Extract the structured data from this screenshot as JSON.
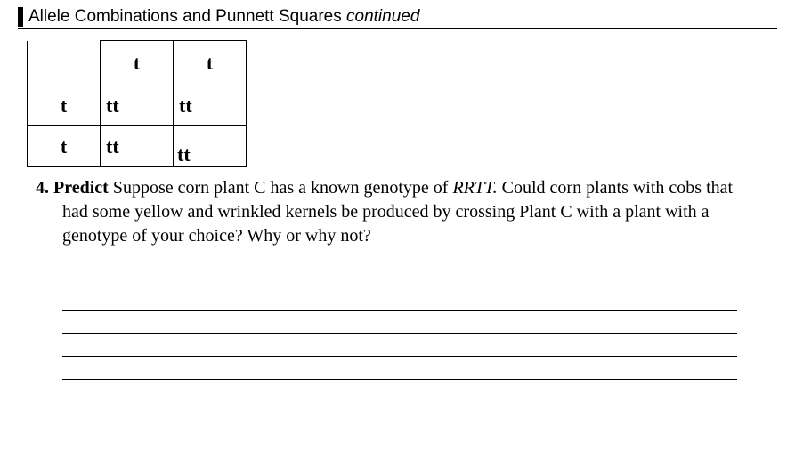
{
  "header": {
    "title_main": "Allele Combinations and Punnett Squares ",
    "title_suffix": "continued"
  },
  "punnett": {
    "col_headers": [
      "",
      "t",
      "t"
    ],
    "rows": [
      {
        "label": "t",
        "cells": [
          "tt",
          "tt"
        ]
      },
      {
        "label": "t",
        "cells": [
          "tt",
          "tt"
        ]
      }
    ]
  },
  "question": {
    "number": "4.",
    "verb": "Predict",
    "text_before_geno": " Suppose corn plant C has a known genotype of ",
    "genotype": "RRTT.",
    "text_after_geno": " Could corn plants with cobs that had some yellow and wrinkled kernels be produced by crossing Plant C with a plant with a genotype of your choice? Why or why not?"
  },
  "answer_line_count": 5
}
